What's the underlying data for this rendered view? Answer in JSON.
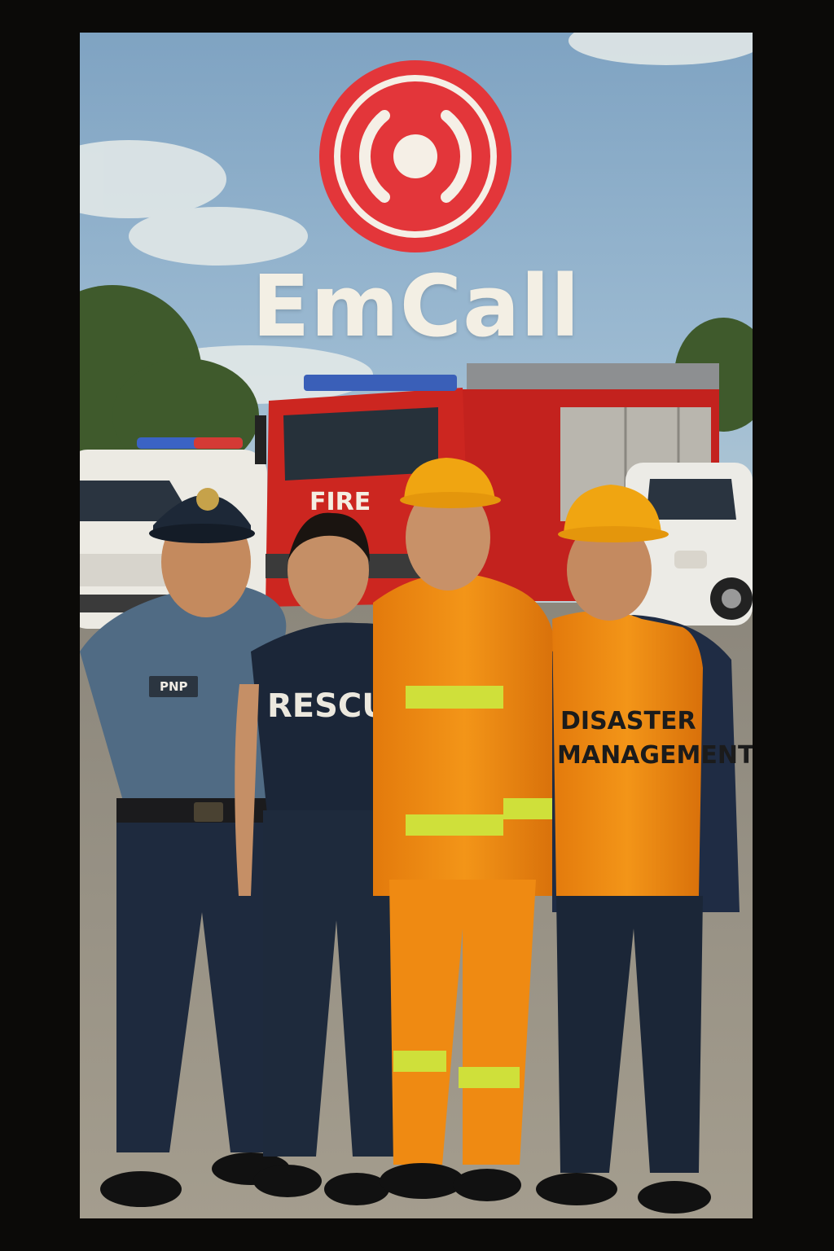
{
  "app": {
    "name": "EmCall"
  },
  "colors": {
    "brand_red": "#e3363a",
    "sky": "#8fb2cf",
    "fire_truck": "#c8231f",
    "turnout_orange": "#f08a12",
    "navy": "#1d2a3f"
  },
  "scene": {
    "truck_label": "FIRE",
    "responders": [
      {
        "badge": "PNP",
        "shirt_text": ""
      },
      {
        "badge": "",
        "shirt_text": "RESCUE"
      },
      {
        "badge": "",
        "shirt_text": ""
      },
      {
        "badge": "",
        "shirt_text": [
          "DISASTER",
          "MANAGEMENT"
        ]
      }
    ]
  },
  "icons": {
    "logo": "emergency-broadcast-icon"
  }
}
